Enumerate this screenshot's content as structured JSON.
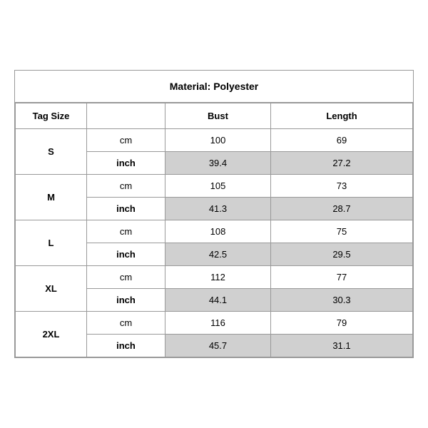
{
  "title": "Material: Polyester",
  "headers": {
    "tag_size": "Tag Size",
    "bust": "Bust",
    "length": "Length"
  },
  "sizes": [
    {
      "tag": "S",
      "cm_bust": "100",
      "cm_length": "69",
      "inch_bust": "39.4",
      "inch_length": "27.2"
    },
    {
      "tag": "M",
      "cm_bust": "105",
      "cm_length": "73",
      "inch_bust": "41.3",
      "inch_length": "28.7"
    },
    {
      "tag": "L",
      "cm_bust": "108",
      "cm_length": "75",
      "inch_bust": "42.5",
      "inch_length": "29.5"
    },
    {
      "tag": "XL",
      "cm_bust": "112",
      "cm_length": "77",
      "inch_bust": "44.1",
      "inch_length": "30.3"
    },
    {
      "tag": "2XL",
      "cm_bust": "116",
      "cm_length": "79",
      "inch_bust": "45.7",
      "inch_length": "31.1"
    }
  ],
  "units": {
    "cm": "cm",
    "inch": "inch"
  }
}
